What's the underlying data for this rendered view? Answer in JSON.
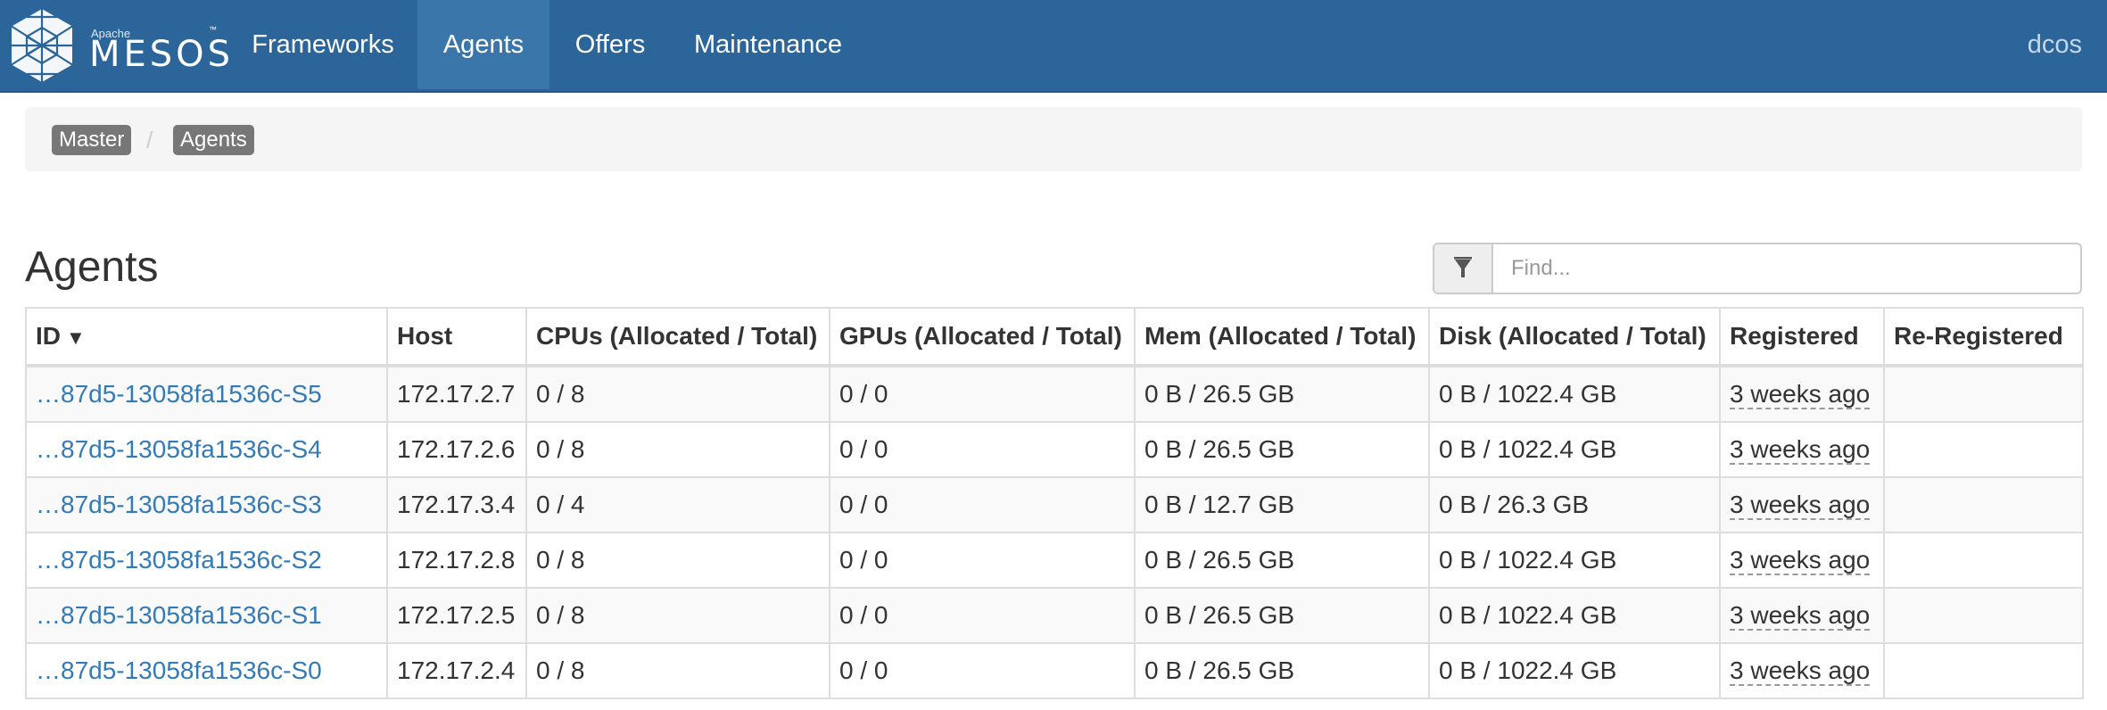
{
  "brand": {
    "apache": "Apache",
    "name": "MESOS",
    "tm": "™"
  },
  "nav": {
    "items": [
      {
        "label": "Frameworks"
      },
      {
        "label": "Agents",
        "active": true
      },
      {
        "label": "Offers"
      },
      {
        "label": "Maintenance"
      }
    ],
    "user": "dcos"
  },
  "breadcrumb": {
    "items": [
      "Master",
      "Agents"
    ],
    "separator": "/"
  },
  "page": {
    "title": "Agents"
  },
  "search": {
    "placeholder": "Find...",
    "icon": "filter-icon"
  },
  "table": {
    "columns": [
      "ID",
      "Host",
      "CPUs (Allocated / Total)",
      "GPUs (Allocated / Total)",
      "Mem (Allocated / Total)",
      "Disk (Allocated / Total)",
      "Registered",
      "Re-Registered"
    ],
    "sort_indicator": "▼",
    "rows": [
      {
        "id": "…87d5-13058fa1536c-S5",
        "host": "172.17.2.7",
        "cpus": "0 / 8",
        "gpus": "0 / 0",
        "mem": "0 B / 26.5 GB",
        "disk": "0 B / 1022.4 GB",
        "registered": "3 weeks ago",
        "reregistered": ""
      },
      {
        "id": "…87d5-13058fa1536c-S4",
        "host": "172.17.2.6",
        "cpus": "0 / 8",
        "gpus": "0 / 0",
        "mem": "0 B / 26.5 GB",
        "disk": "0 B / 1022.4 GB",
        "registered": "3 weeks ago",
        "reregistered": ""
      },
      {
        "id": "…87d5-13058fa1536c-S3",
        "host": "172.17.3.4",
        "cpus": "0 / 4",
        "gpus": "0 / 0",
        "mem": "0 B / 12.7 GB",
        "disk": "0 B / 26.3 GB",
        "registered": "3 weeks ago",
        "reregistered": ""
      },
      {
        "id": "…87d5-13058fa1536c-S2",
        "host": "172.17.2.8",
        "cpus": "0 / 8",
        "gpus": "0 / 0",
        "mem": "0 B / 26.5 GB",
        "disk": "0 B / 1022.4 GB",
        "registered": "3 weeks ago",
        "reregistered": ""
      },
      {
        "id": "…87d5-13058fa1536c-S1",
        "host": "172.17.2.5",
        "cpus": "0 / 8",
        "gpus": "0 / 0",
        "mem": "0 B / 26.5 GB",
        "disk": "0 B / 1022.4 GB",
        "registered": "3 weeks ago",
        "reregistered": ""
      },
      {
        "id": "…87d5-13058fa1536c-S0",
        "host": "172.17.2.4",
        "cpus": "0 / 8",
        "gpus": "0 / 0",
        "mem": "0 B / 26.5 GB",
        "disk": "0 B / 1022.4 GB",
        "registered": "3 weeks ago",
        "reregistered": ""
      }
    ]
  },
  "colors": {
    "navbar": "#2c6599",
    "nav_active": "#3b76ab",
    "link": "#337ab7",
    "breadcrumb_label": "#777777"
  }
}
